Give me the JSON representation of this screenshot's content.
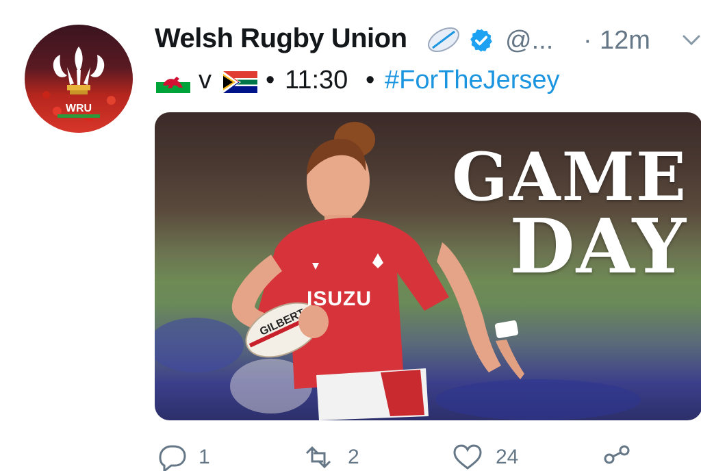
{
  "tweet": {
    "author_name": "Welsh Rugby Union",
    "handle": "@...",
    "separator": "·",
    "time_ago": "12m",
    "text_vs": "v",
    "text_bullet": "•",
    "kickoff_time": "11:30",
    "hashtag": "#ForTheJersey",
    "avatar_text": "WRU",
    "media": {
      "headline_line1": "GAME",
      "headline_line2": "DAY"
    }
  },
  "actions": {
    "reply_count": "1",
    "retweet_count": "2",
    "like_count": "24"
  },
  "colors": {
    "link": "#1b95e0",
    "muted": "#657786",
    "verified": "#1da1f2",
    "wales_red": "#d21034"
  },
  "icons": [
    "rugby-ball-icon",
    "verified-badge-icon",
    "chevron-down-icon",
    "wales-flag-icon",
    "south-africa-flag-icon",
    "reply-icon",
    "retweet-icon",
    "like-icon",
    "share-icon"
  ]
}
